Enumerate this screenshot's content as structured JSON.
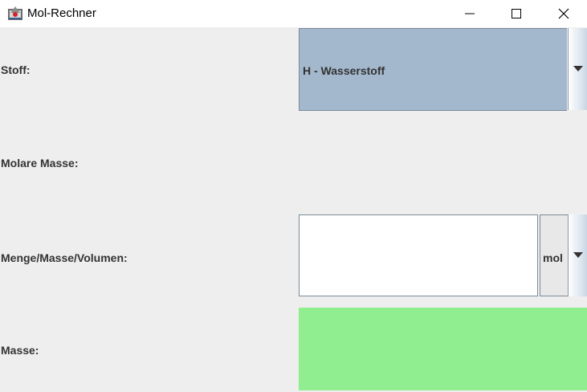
{
  "window": {
    "title": "Mol-Rechner"
  },
  "form": {
    "stoff_label": "Stoff:",
    "stoff_value": "H - Wasserstoff",
    "molare_masse_label": "Molare Masse:",
    "menge_label": "Menge/Masse/Volumen:",
    "menge_value": "",
    "unit_value": "mol",
    "masse_label": "Masse:"
  },
  "icons": {
    "app": "app-icon",
    "minimize": "minimize-icon",
    "maximize": "maximize-icon",
    "close": "close-icon",
    "dropdown": "chevron-down-icon"
  },
  "colors": {
    "selected_combo": "#a3b8cc",
    "result_background": "#90ee90",
    "window_background": "#eeeeee"
  }
}
